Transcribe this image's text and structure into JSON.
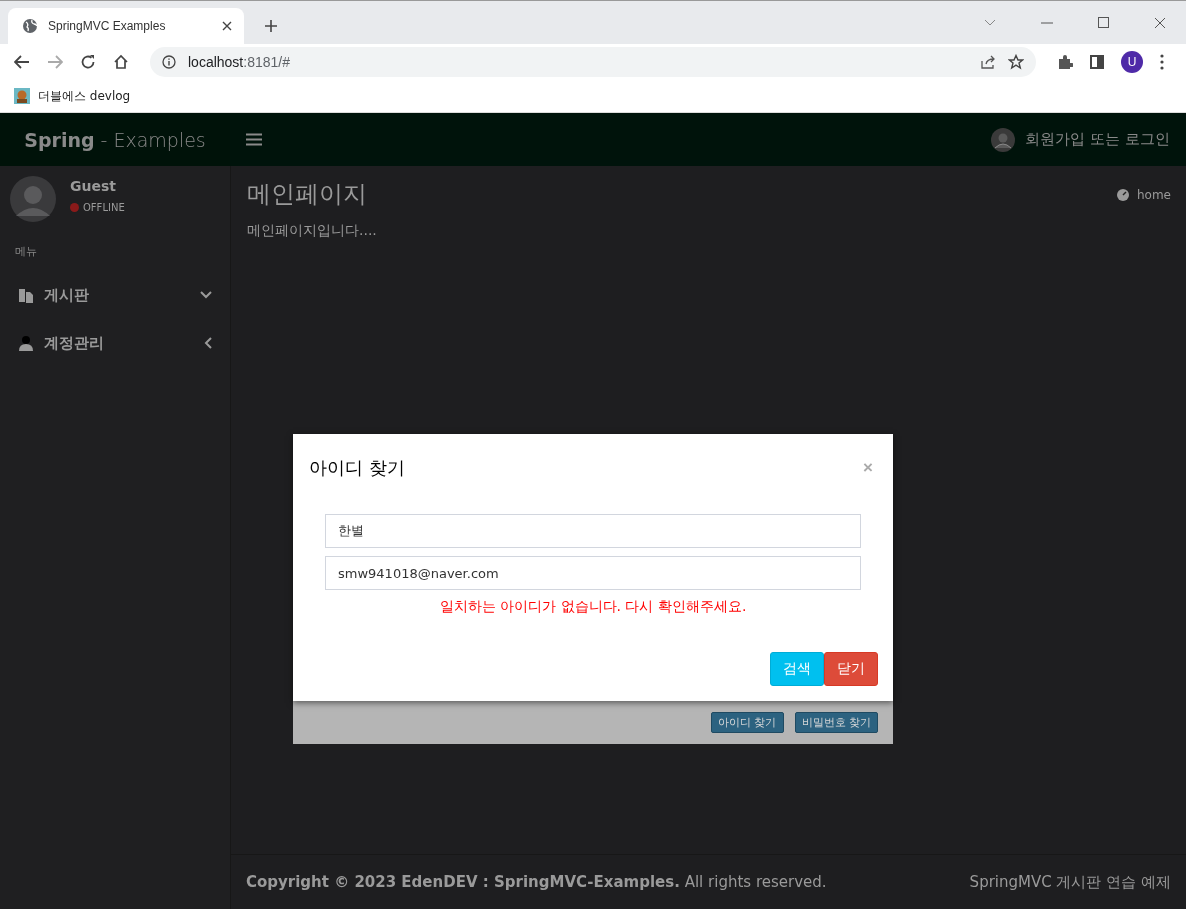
{
  "browser": {
    "tab_title": "SpringMVC Examples",
    "address_host": "localhost",
    "address_rest": ":8181/#",
    "bookmark": "더블에스 devlog",
    "profile": "U"
  },
  "header": {
    "logo_bold": "Spring",
    "logo_rest": "- Examples",
    "user_link": "회원가입 또는 로그인"
  },
  "sidebar": {
    "user": {
      "name": "Guest",
      "status": "OFFLINE",
      "online": false
    },
    "menu_header": "메뉴",
    "items": [
      {
        "label": "게시판",
        "kind": "board",
        "expanded": true
      },
      {
        "label": "계정관리",
        "kind": "account",
        "expanded": false
      }
    ]
  },
  "content": {
    "title": "메인페이지",
    "breadcrumb": "home",
    "body": "메인페이지입니다...."
  },
  "login_panel": {
    "buttons": [
      "아이디 찾기",
      "비밀번호 찾기"
    ]
  },
  "modal": {
    "title": "아이디 찾기",
    "close": "×",
    "fields": [
      {
        "value": "한별"
      },
      {
        "value": "smw941018@naver.com"
      }
    ],
    "message": "일치하는 아이디가 없습니다. 다시 확인해주세요.",
    "buttons": [
      {
        "label": "검색",
        "kind": "info"
      },
      {
        "label": "닫기",
        "kind": "danger"
      }
    ]
  },
  "footer": {
    "left": "**Copyright © 2023 EdenDEV : SpringMVC-Examples.** All rights reserved.",
    "right": "SpringMVC 게시판 연습 예제"
  }
}
